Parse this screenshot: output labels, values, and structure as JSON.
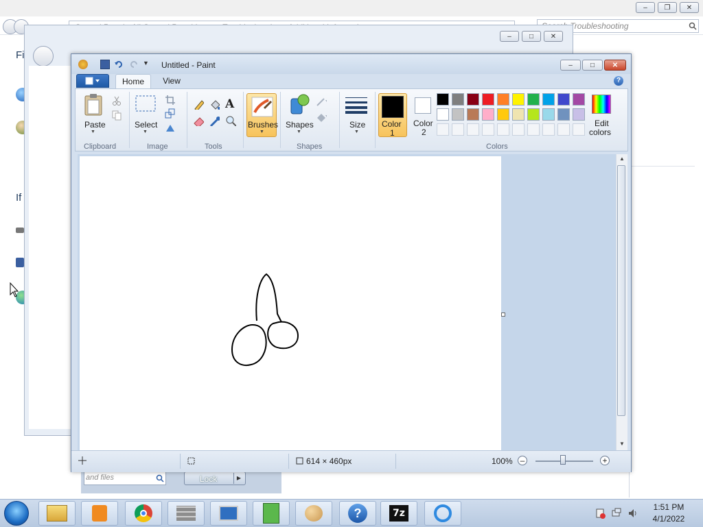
{
  "background_window": {
    "breadcrumb": "Control Panel  ›  All Control Panel Items  ›  Troubleshooting  ›  Additional Information",
    "search_placeholder": "Search Troubleshooting",
    "heading_partial": "Fi",
    "text_partial": "If"
  },
  "start_menu": {
    "search_placeholder": "and files",
    "lock_label": "Lock"
  },
  "paint": {
    "title": "Untitled - Paint",
    "tabs": [
      "Home",
      "View"
    ],
    "clipboard": {
      "paste_label": "Paste",
      "group_label": "Clipboard"
    },
    "image": {
      "select_label": "Select",
      "group_label": "Image"
    },
    "tools": {
      "group_label": "Tools"
    },
    "brushes": {
      "label": "Brushes"
    },
    "shapes": {
      "label": "Shapes",
      "group_label": "Shapes"
    },
    "size": {
      "label": "Size"
    },
    "color1": {
      "label_line1": "Color",
      "label_line2": "1",
      "value": "#000000"
    },
    "color2": {
      "label_line1": "Color",
      "label_line2": "2",
      "value": "#ffffff"
    },
    "colors": {
      "group_label": "Colors",
      "edit_line1": "Edit",
      "edit_line2": "colors",
      "row1": [
        "#000000",
        "#7f7f7f",
        "#880015",
        "#ed1c24",
        "#ff7f27",
        "#fff200",
        "#22b14c",
        "#00a2e8",
        "#3f48cc",
        "#a349a4"
      ],
      "row2": [
        "#ffffff",
        "#c3c3c3",
        "#b97a57",
        "#ffaec9",
        "#ffc90e",
        "#efe4b0",
        "#b5e61d",
        "#99d9ea",
        "#7092be",
        "#c8bfe7"
      ]
    },
    "status": {
      "dimensions": "614 × 460px",
      "zoom": "100%"
    }
  },
  "taskbar": {
    "time": "1:51 PM",
    "date": "4/1/2022",
    "pinned": [
      "windows-explorer-icon",
      "media-player-icon",
      "chrome-icon",
      "firewall-icon",
      "remote-desktop-icon",
      "notepad-icon",
      "paint-icon",
      "help-icon",
      "7zip-icon",
      "internet-explorer-icon"
    ]
  }
}
